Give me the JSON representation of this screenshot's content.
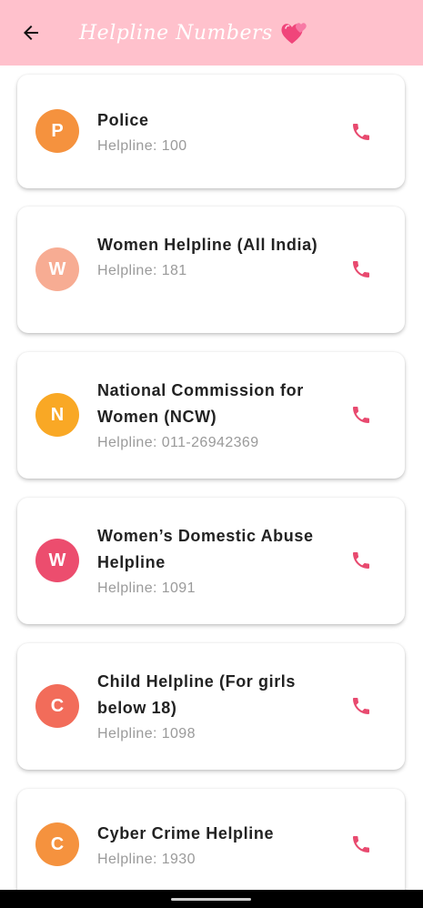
{
  "appbar": {
    "title": "Helpline Numbers",
    "back_icon": "arrow-left-icon",
    "emoji_icon": "two-hearts-icon",
    "background": "#ffc1cc"
  },
  "helplines": [
    {
      "initial": "P",
      "name": "Police",
      "number": "Helpline: 100",
      "avatar_color": "#f5923e"
    },
    {
      "initial": "W",
      "name": "Women Helpline (All India)",
      "number": "Helpline: 181",
      "avatar_color": "#f7ac93"
    },
    {
      "initial": "N",
      "name": "National Commission for Women (NCW)",
      "number": "Helpline: 011-26942369",
      "avatar_color": "#f9a825"
    },
    {
      "initial": "W",
      "name": "Women’s Domestic Abuse Helpline",
      "number": "Helpline: 1091",
      "avatar_color": "#ec4d6e"
    },
    {
      "initial": "C",
      "name": "Child Helpline (For girls below 18)",
      "number": "Helpline: 1098",
      "avatar_color": "#f26c5a"
    },
    {
      "initial": "C",
      "name": "Cyber Crime Helpline",
      "number": "Helpline: 1930",
      "avatar_color": "#f5923e"
    }
  ],
  "call_icon": "phone-icon",
  "call_icon_color": "#e84a6f"
}
